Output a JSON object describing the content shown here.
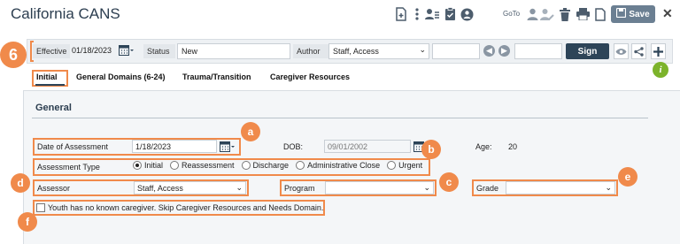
{
  "window": {
    "title": "California CANS",
    "goto_label": "GoTo",
    "save_label": "Save",
    "close_glyph": "✕"
  },
  "header": {
    "effective_label": "Effective",
    "effective_value": "01/18/2023",
    "status_label": "Status",
    "status_value": "New",
    "author_label": "Author",
    "author_value": "Staff, Access",
    "sign_label": "Sign"
  },
  "tabs": [
    {
      "label": "Initial",
      "active": true
    },
    {
      "label": "General Domains (6-24)"
    },
    {
      "label": "Trauma/Transition"
    },
    {
      "label": "Caregiver Resources"
    }
  ],
  "section": {
    "title": "General"
  },
  "form": {
    "date_label": "Date of Assessment",
    "date_value": "1/18/2023",
    "dob_label": "DOB:",
    "dob_value": "09/01/2002",
    "age_label": "Age:",
    "age_value": "20",
    "type_label": "Assessment Type",
    "type_options": [
      "Initial",
      "Reassessment",
      "Discharge",
      "Administrative Close",
      "Urgent"
    ],
    "type_selected": "Initial",
    "assessor_label": "Assessor",
    "assessor_value": "Staff, Access",
    "program_label": "Program",
    "program_value": "",
    "grade_label": "Grade",
    "grade_value": "",
    "caregiver_checkbox_label": "Youth has no known caregiver. Skip Caregiver Resources and Needs Domain."
  },
  "callouts": {
    "step": "6",
    "a": "a",
    "b": "b",
    "c": "c",
    "d": "d",
    "e": "e",
    "f": "f"
  },
  "icons": [
    "document-plus-icon",
    "kebab-menu-icon",
    "user-list-icon",
    "clipboard-check-icon",
    "goto-icon",
    "user-icon",
    "user-edit-icon",
    "trash-icon",
    "print-icon",
    "page-icon",
    "save-icon",
    "calendar-icon",
    "prev-icon",
    "next-icon",
    "eye-icon",
    "share-icon",
    "plus-icon",
    "info-icon"
  ],
  "colors": {
    "accent_orange": "#f08a4b",
    "sign_button": "#2d4458",
    "info_green": "#7cb32b",
    "save_button": "#6b7f92"
  }
}
